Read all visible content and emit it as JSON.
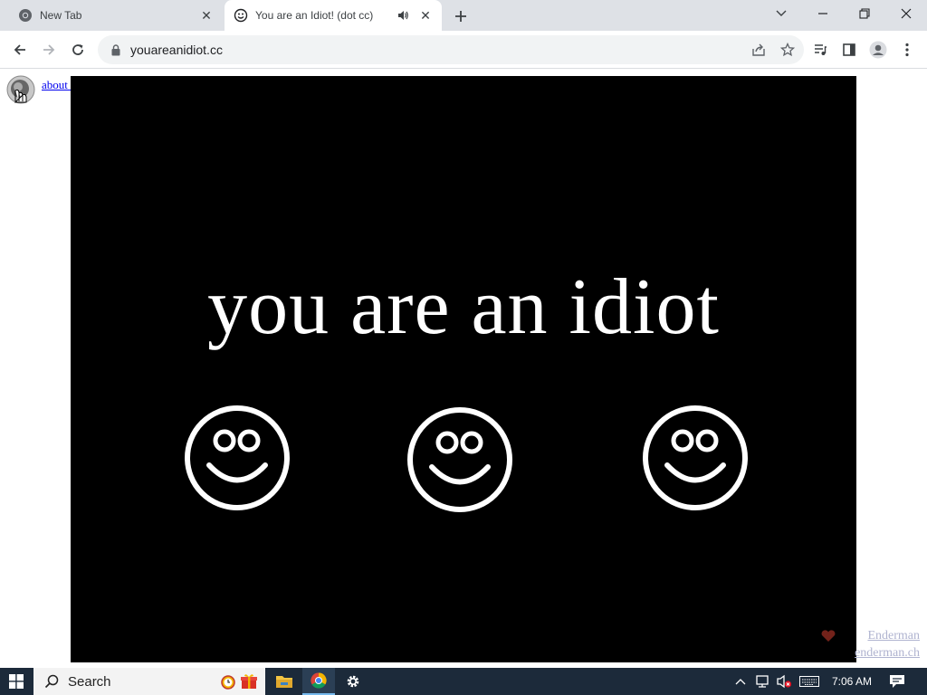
{
  "tabs": [
    {
      "title": "New Tab",
      "favicon": "chrome-icon"
    },
    {
      "title": "You are an Idiot! (dot cc)",
      "favicon": "smiley-icon",
      "audio": "speaker-icon"
    }
  ],
  "address_bar": {
    "url": "youareanidiot.cc"
  },
  "page": {
    "link_text": "about | enable sauce",
    "headline": "you are an idiot",
    "smiley_count": 3,
    "credit_name": "Enderman",
    "credit_url": "enderman.ch"
  },
  "taskbar": {
    "search_placeholder": "Search",
    "time": "7:06 AM"
  },
  "colors": {
    "tabstrip_bg": "#dee1e6",
    "video_bg": "#000000",
    "headline": "#ffffff",
    "link": "#0000ee",
    "taskbar_bg": "#1c2a3a"
  }
}
